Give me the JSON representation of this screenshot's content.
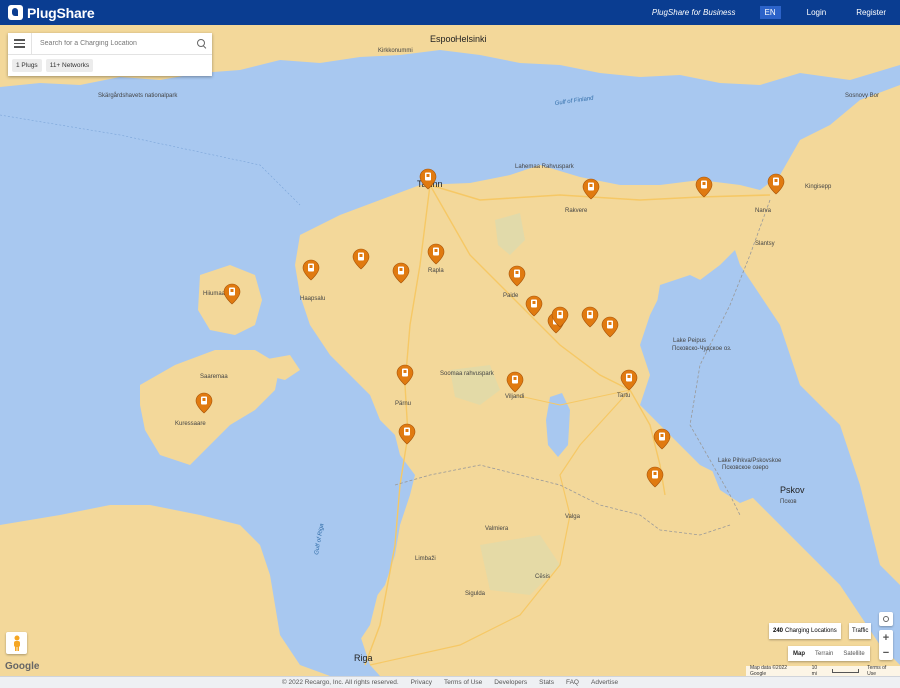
{
  "header": {
    "brand": "PlugShare",
    "business_link": "PlugShare for Business",
    "language": "EN",
    "login": "Login",
    "register": "Register"
  },
  "search": {
    "placeholder": "Search for a Charging Location",
    "filters": [
      "1 Plugs",
      "11+ Networks"
    ]
  },
  "map": {
    "stats_count": "240",
    "stats_label": "Charging Locations",
    "traffic": "Traffic",
    "map_types": [
      "Map",
      "Terrain",
      "Satellite"
    ],
    "active_map_type": "Map",
    "google": "Google",
    "attribution": "Map data ©2022 Google",
    "scale": "10 mi",
    "terms": "Terms of Use",
    "pin_color": "#e07a10",
    "pin_count": 22,
    "labels": {
      "helsinki": "Helsinki",
      "espoo": "Espoo",
      "tallinn": "Tallinn",
      "riga": "Riga",
      "pskov": "Pskov",
      "pskov_ru": "Псков",
      "narva": "Narva",
      "tartu": "Tartu",
      "parnu": "Pärnu",
      "gulf_finland": "Gulf of Finland",
      "gulf_riga": "Gulf of Riga",
      "lake_peipus": "Lake Peipus",
      "lake_peipus_ru": "Псковско-Чудское оз.",
      "lake_pskov": "Lake Pihkva/Pskovskoe",
      "lake_pskov_ru": "Псковское озеро",
      "saaremaa": "Saaremaa",
      "hiiumaa": "Hiiumaa",
      "lahemaa": "Lahemaa Rahvuspark",
      "soomaa": "Soomaa rahvuspark",
      "kuressaare": "Kuressaare",
      "valga": "Valga",
      "cesis": "Cēsis",
      "sigulda": "Sigulda",
      "valmiera": "Valmiera",
      "limbazi": "Limbaži",
      "viljandi": "Viljandi",
      "paide": "Paide",
      "rakvere": "Rakvere",
      "haapsalu": "Haapsalu",
      "rapla": "Rapla",
      "kingisepp": "Kingisepp",
      "slantsy": "Slantsy",
      "porvoo_label": "Sosnovy Bor",
      "kirkkonummi": "Kirkkonummi",
      "skargard": "Skärgårdshavets nationalpark"
    }
  },
  "footer": {
    "copyright": "© 2022 Recargo, Inc. All rights reserved.",
    "links": [
      "Privacy",
      "Terms of Use",
      "Developers",
      "Stats",
      "FAQ",
      "Advertise"
    ]
  }
}
